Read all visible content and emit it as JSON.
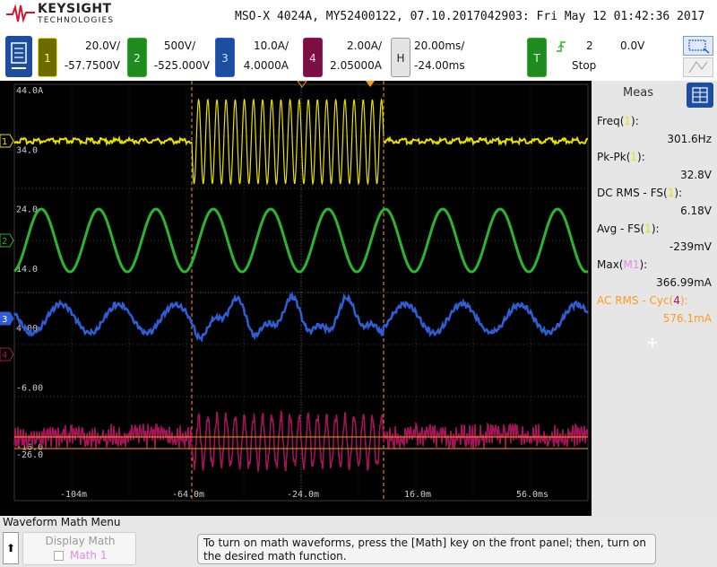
{
  "brand": {
    "name": "KEYSIGHT",
    "sub": "TECHNOLOGIES"
  },
  "title": "MSO-X 4024A, MY52400122, 07.10.2017042903: Fri May 12 01:42:36 2017",
  "channels": [
    {
      "num": "1",
      "scale": "20.0V/",
      "offset": "-57.7500V",
      "color": "#e8e000"
    },
    {
      "num": "2",
      "scale": "500V/",
      "offset": "-525.000V",
      "color": "#2db52d"
    },
    {
      "num": "3",
      "scale": "10.0A/",
      "offset": "4.0000A",
      "color": "#2e5ed6"
    },
    {
      "num": "4",
      "scale": "2.00A/",
      "offset": "2.05000A",
      "color": "#a8145c"
    }
  ],
  "horizontal": {
    "key": "H",
    "scale": "20.00ms/",
    "delay": "-24.00ms"
  },
  "trigger": {
    "key": "T",
    "source": "2",
    "level": "0.0V",
    "state": "Stop",
    "slope_icon": "rising-edge-icon"
  },
  "graticule": {
    "left_labels": [
      "44.0A",
      "34.0",
      "24.0",
      "14.0",
      "4.00",
      "-6.00",
      "-16.0",
      "-26.0"
    ],
    "time_labels": [
      "-104m",
      "-64.0m",
      "-24.0m",
      "16.0m",
      "56.0ms"
    ],
    "ground_markers": [
      "1",
      "2",
      "3",
      "4"
    ]
  },
  "meas": {
    "title": "Meas",
    "items": [
      {
        "label": "Freq(",
        "src": "1",
        "close": "):",
        "value": "301.6Hz",
        "src_color": "#e8e000",
        "color": "#111111"
      },
      {
        "label": "Pk-Pk(",
        "src": "1",
        "close": "):",
        "value": "32.8V",
        "src_color": "#e8e000",
        "color": "#111111"
      },
      {
        "label": "DC RMS - FS(",
        "src": "1",
        "close": "):",
        "value": "6.18V",
        "src_color": "#e8e000",
        "color": "#111111"
      },
      {
        "label": "Avg - FS(",
        "src": "1",
        "close": "):",
        "value": "-239mV",
        "src_color": "#e8e000",
        "color": "#111111"
      },
      {
        "label": "Max(",
        "src": "M1",
        "close": "):",
        "value": "366.99mA",
        "src_color": "#e48be4",
        "color": "#111111"
      },
      {
        "label": "AC RMS - Cyc(",
        "src": "4",
        "close": "):",
        "value": "576.1mA",
        "src_color": "#a8145c",
        "color": "#ff9a1a"
      }
    ],
    "add_symbol": "+"
  },
  "menu": {
    "title": "Waveform Math Menu",
    "back_symbol": "⬆",
    "softkey_label": "Display Math",
    "softkey_sub": "Math 1",
    "help": "To turn on math waveforms, press the [Math] key on the front panel; then, turn on the desired math function."
  }
}
